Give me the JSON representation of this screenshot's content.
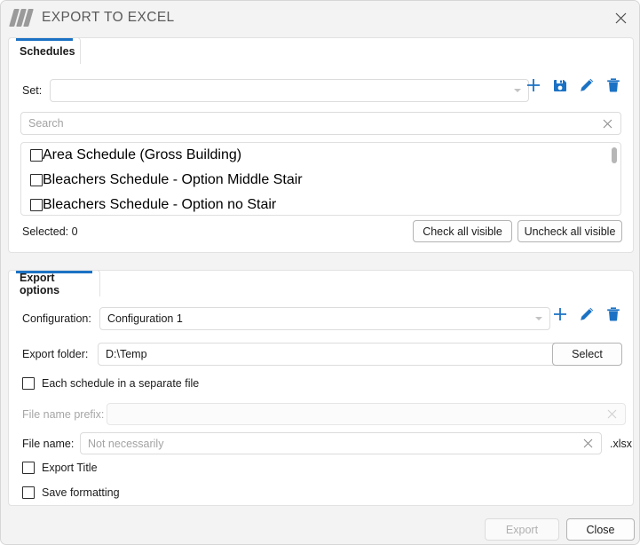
{
  "window": {
    "title": "EXPORT TO EXCEL",
    "logo_icon": "app-logo-icon",
    "close_icon": "close-icon"
  },
  "accent_color": "#1b72c4",
  "schedules": {
    "tab_label": "Schedules",
    "set_label": "Set:",
    "set_value": "",
    "set_dropdown_icon": "chevron-down-icon",
    "tools": [
      {
        "name": "add-set-button",
        "icon": "plus-icon"
      },
      {
        "name": "save-set-button",
        "icon": "save-icon"
      },
      {
        "name": "edit-set-button",
        "icon": "pencil-icon"
      },
      {
        "name": "delete-set-button",
        "icon": "trash-icon"
      }
    ],
    "search_placeholder": "Search",
    "search_value": "",
    "search_clear_icon": "clear-icon",
    "items": [
      {
        "label": "Area Schedule (Gross Building)",
        "checked": false
      },
      {
        "label": "Bleachers Schedule - Option Middle Stair",
        "checked": false
      },
      {
        "label": "Bleachers Schedule - Option no Stair",
        "checked": false
      }
    ],
    "selected_text": "Selected: 0",
    "check_all_label": "Check all visible",
    "uncheck_all_label": "Uncheck all visible"
  },
  "export_options": {
    "tab_label": "Export options",
    "configuration_label": "Configuration:",
    "configuration_value": "Configuration 1",
    "configuration_dropdown_icon": "chevron-down-icon",
    "config_tools": [
      {
        "name": "add-configuration-button",
        "icon": "plus-icon"
      },
      {
        "name": "edit-configuration-button",
        "icon": "pencil-icon"
      },
      {
        "name": "delete-configuration-button",
        "icon": "trash-icon"
      }
    ],
    "export_folder_label": "Export folder:",
    "export_folder_value": "D:\\Temp",
    "select_label": "Select",
    "separate_file_label": "Each schedule in a separate file",
    "separate_file_checked": false,
    "prefix_label": "File name prefix:",
    "prefix_value": "",
    "prefix_clear_icon": "clear-icon",
    "file_name_label": "File name:",
    "file_name_placeholder": "Not necessarily",
    "file_name_value": "",
    "file_name_clear_icon": "clear-icon",
    "extension": ".xlsx",
    "export_title_label": "Export Title",
    "export_title_checked": false,
    "save_formatting_label": "Save formatting",
    "save_formatting_checked": false
  },
  "footer": {
    "export_label": "Export",
    "close_label": "Close"
  }
}
